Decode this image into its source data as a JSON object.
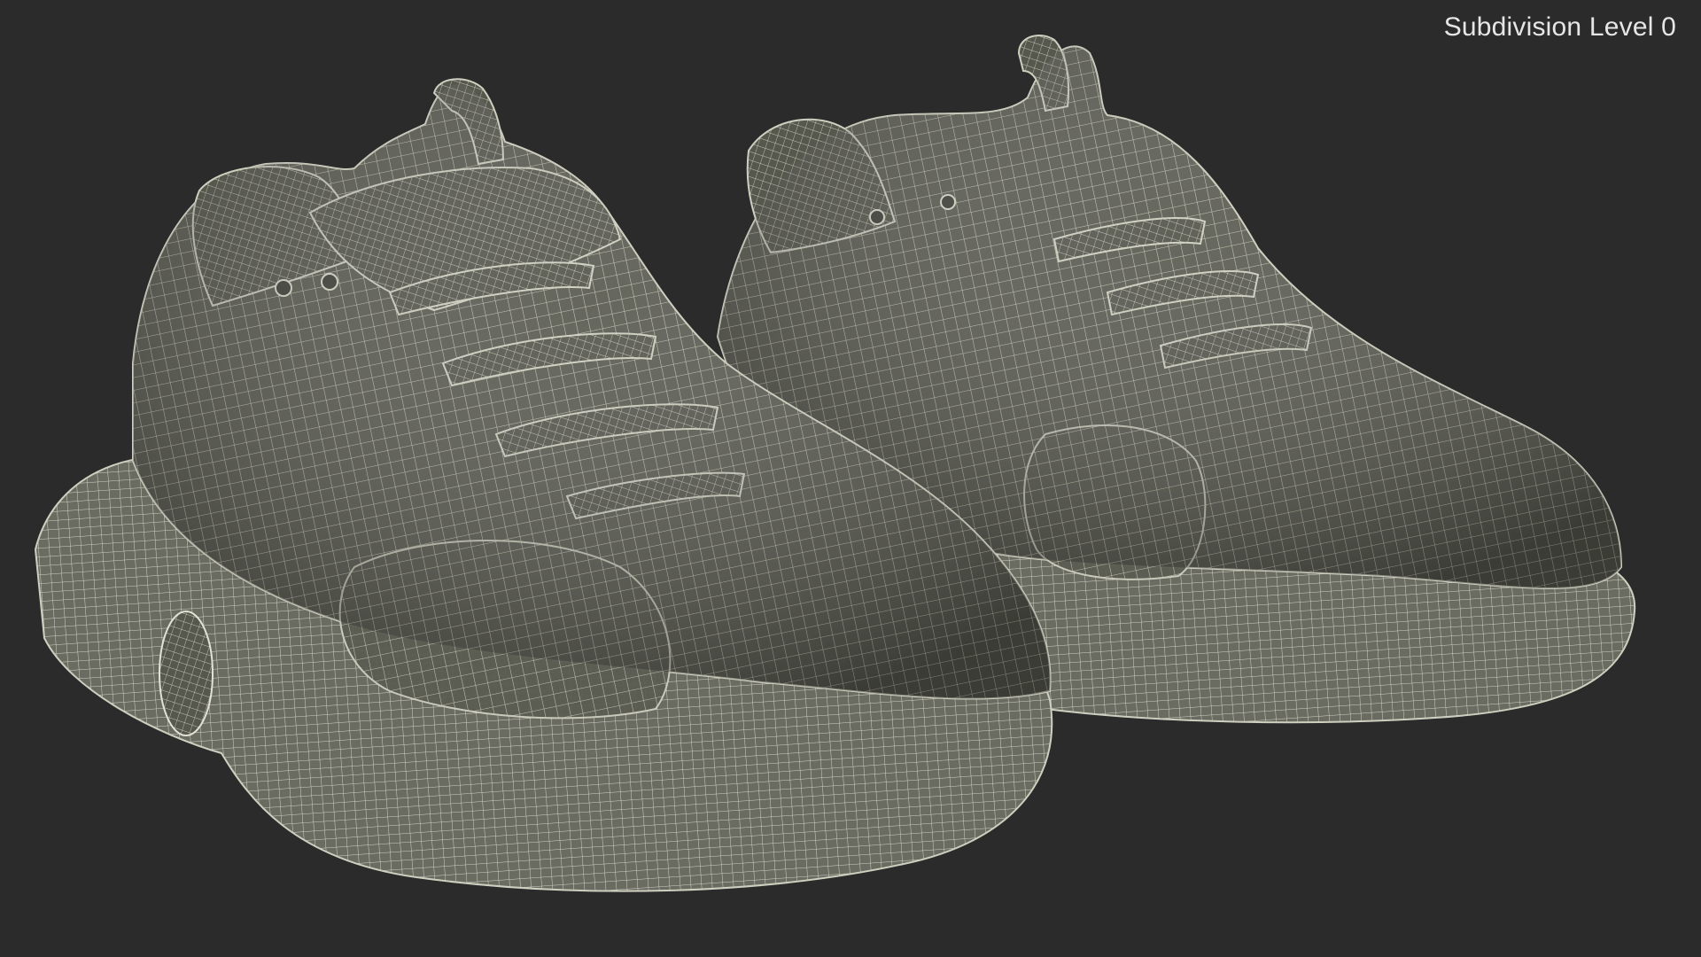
{
  "render": {
    "label": "Subdivision Level 0",
    "background_color": "#2b2b2b",
    "surface_color": "#5b5c52",
    "wire_color": "#d8d8c8"
  },
  "subject": {
    "object_icons": [
      "sneaker-left",
      "sneaker-right"
    ]
  }
}
